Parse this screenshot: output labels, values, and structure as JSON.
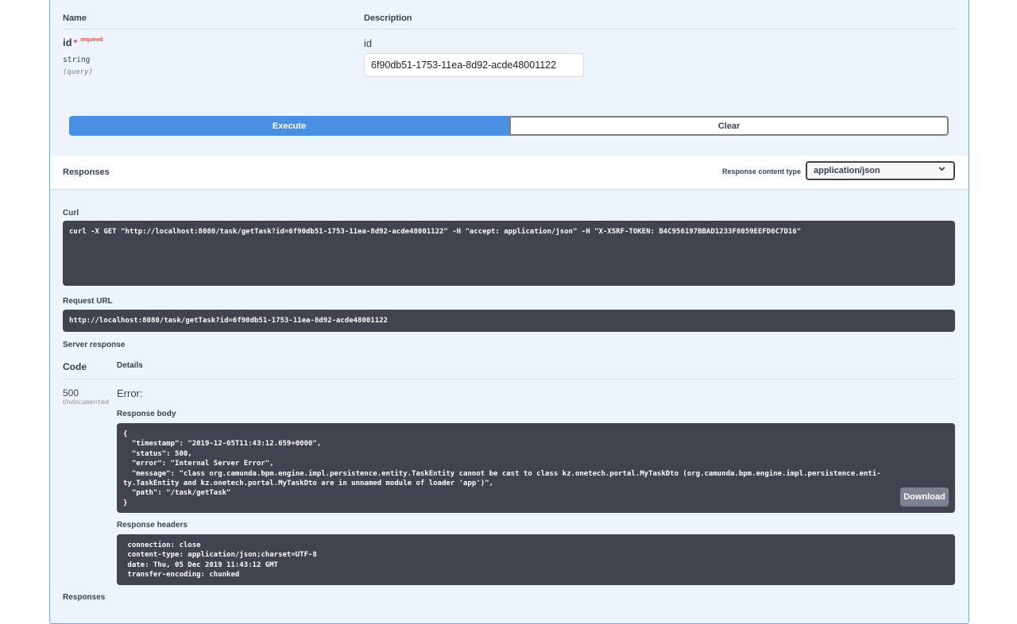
{
  "params": {
    "col_name": "Name",
    "col_description": "Description",
    "items": [
      {
        "name": "id",
        "required_star": "*",
        "required_text": "required",
        "type": "string",
        "location": "(query)",
        "description": "id",
        "value": "6f90db51-1753-11ea-8d92-acde48001122"
      }
    ]
  },
  "buttons": {
    "execute": "Execute",
    "clear": "Clear"
  },
  "responses_header": {
    "title": "Responses",
    "content_type_label": "Response content type",
    "content_type_value": "application/json"
  },
  "curl": {
    "label": "Curl",
    "command": "curl -X GET \"http://localhost:8080/task/getTask?id=6f90db51-1753-11ea-8d92-acde48001122\" -H \"accept: application/json\" -H \"X-XSRF-TOKEN: B4C956197BBAD1233F8059EEFD6C7D16\""
  },
  "request_url": {
    "label": "Request URL",
    "url": "http://localhost:8080/task/getTask?id=6f90db51-1753-11ea-8d92-acde48001122"
  },
  "server_response": {
    "label": "Server response",
    "col_code": "Code",
    "col_details": "Details",
    "code": "500",
    "code_note": "Undocumented",
    "error_title": "Error:",
    "body_label": "Response body",
    "body": "{\n  \"timestamp\": \"2019-12-05T11:43:12.659+0000\",\n  \"status\": 500,\n  \"error\": \"Internal Server Error\",\n  \"message\": \"class org.camunda.bpm.engine.impl.persistence.entity.TaskEntity cannot be cast to class kz.onetech.portal.MyTaskDto (org.camunda.bpm.engine.impl.persistence.enti-\nty.TaskEntity and kz.onetech.portal.MyTaskDto are in unnamed module of loader 'app')\",\n  \"path\": \"/task/getTask\"\n}",
    "download_label": "Download",
    "headers_label": "Response headers",
    "headers": " connection: close\n content-type: application/json;charset=UTF-8\n date: Thu, 05 Dec 2019 11:43:12 GMT\n transfer-encoding: chunked"
  },
  "footer": {
    "responses_label": "Responses"
  },
  "colors": {
    "accent": "#61affe",
    "execute_bg": "#4990e2",
    "code_bg": "#41444e",
    "required": "#f93e3e"
  }
}
